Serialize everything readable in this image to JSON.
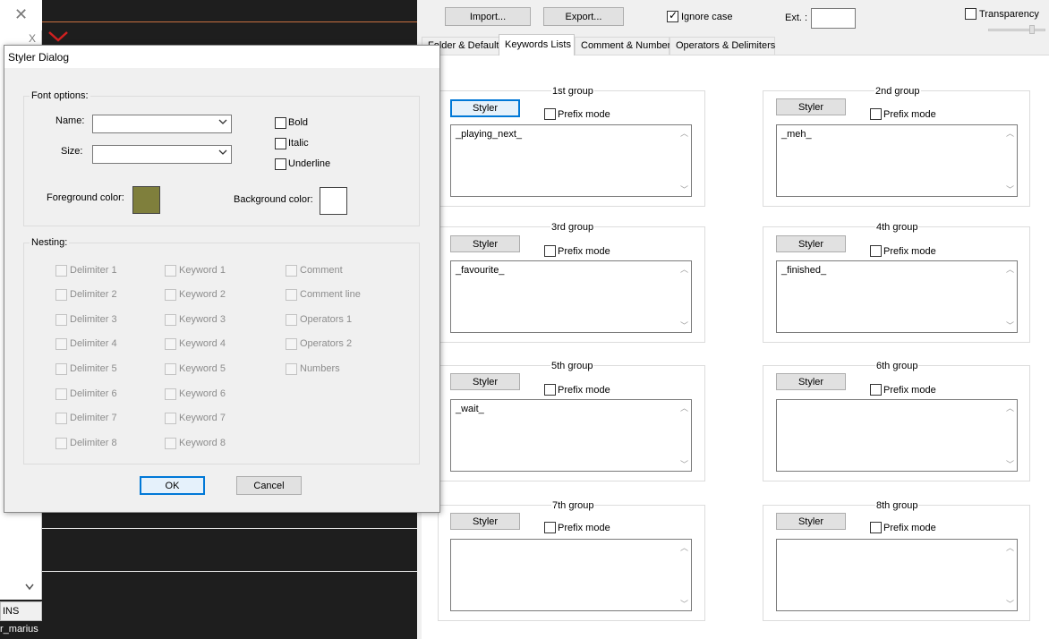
{
  "left": {
    "status_ins": "INS",
    "status_user": "r_marius",
    "close_glyph": "✕",
    "small_close": "X",
    "red_mark": "V"
  },
  "toolbar": {
    "import_label": "Import...",
    "export_label": "Export...",
    "ignore_case_label": "Ignore case",
    "ignore_case_checked": true,
    "ext_label": "Ext. :",
    "ext_value": "",
    "transparency_label": "Transparency"
  },
  "tabs": [
    {
      "label": "Folder & Default",
      "active": false
    },
    {
      "label": "Keywords Lists",
      "active": true
    },
    {
      "label": "Comment & Number",
      "active": false
    },
    {
      "label": "Operators & Delimiters",
      "active": false
    }
  ],
  "groups": [
    {
      "title": "1st group",
      "styler": "Styler",
      "prefix": "Prefix mode",
      "keywords": "_playing_next_"
    },
    {
      "title": "2nd group",
      "styler": "Styler",
      "prefix": "Prefix mode",
      "keywords": "_meh_"
    },
    {
      "title": "3rd group",
      "styler": "Styler",
      "prefix": "Prefix mode",
      "keywords": "_favourite_"
    },
    {
      "title": "4th group",
      "styler": "Styler",
      "prefix": "Prefix mode",
      "keywords": "_finished_"
    },
    {
      "title": "5th group",
      "styler": "Styler",
      "prefix": "Prefix mode",
      "keywords": "_wait_"
    },
    {
      "title": "6th group",
      "styler": "Styler",
      "prefix": "Prefix mode",
      "keywords": ""
    },
    {
      "title": "7th group",
      "styler": "Styler",
      "prefix": "Prefix mode",
      "keywords": ""
    },
    {
      "title": "8th group",
      "styler": "Styler",
      "prefix": "Prefix mode",
      "keywords": ""
    }
  ],
  "dialog": {
    "title": "Styler Dialog",
    "font_options_legend": "Font options:",
    "name_label": "Name:",
    "size_label": "Size:",
    "bold_label": "Bold",
    "italic_label": "Italic",
    "underline_label": "Underline",
    "fg_label": "Foreground color:",
    "bg_label": "Background color:",
    "fg_color": "#7f7f3c",
    "bg_color": "#ffffff",
    "nesting_legend": "Nesting:",
    "nesting_col1": [
      "Delimiter 1",
      "Delimiter 2",
      "Delimiter 3",
      "Delimiter 4",
      "Delimiter 5",
      "Delimiter 6",
      "Delimiter 7",
      "Delimiter 8"
    ],
    "nesting_col2": [
      "Keyword 1",
      "Keyword 2",
      "Keyword 3",
      "Keyword 4",
      "Keyword 5",
      "Keyword 6",
      "Keyword 7",
      "Keyword 8"
    ],
    "nesting_col3": [
      "Comment",
      "Comment line",
      "Operators 1",
      "Operators 2",
      "Numbers"
    ],
    "ok_label": "OK",
    "cancel_label": "Cancel"
  },
  "icons": {
    "combo_arrow": "chevron-down-icon",
    "scroll_up": "scroll-up-icon",
    "scroll_down": "scroll-down-icon"
  }
}
